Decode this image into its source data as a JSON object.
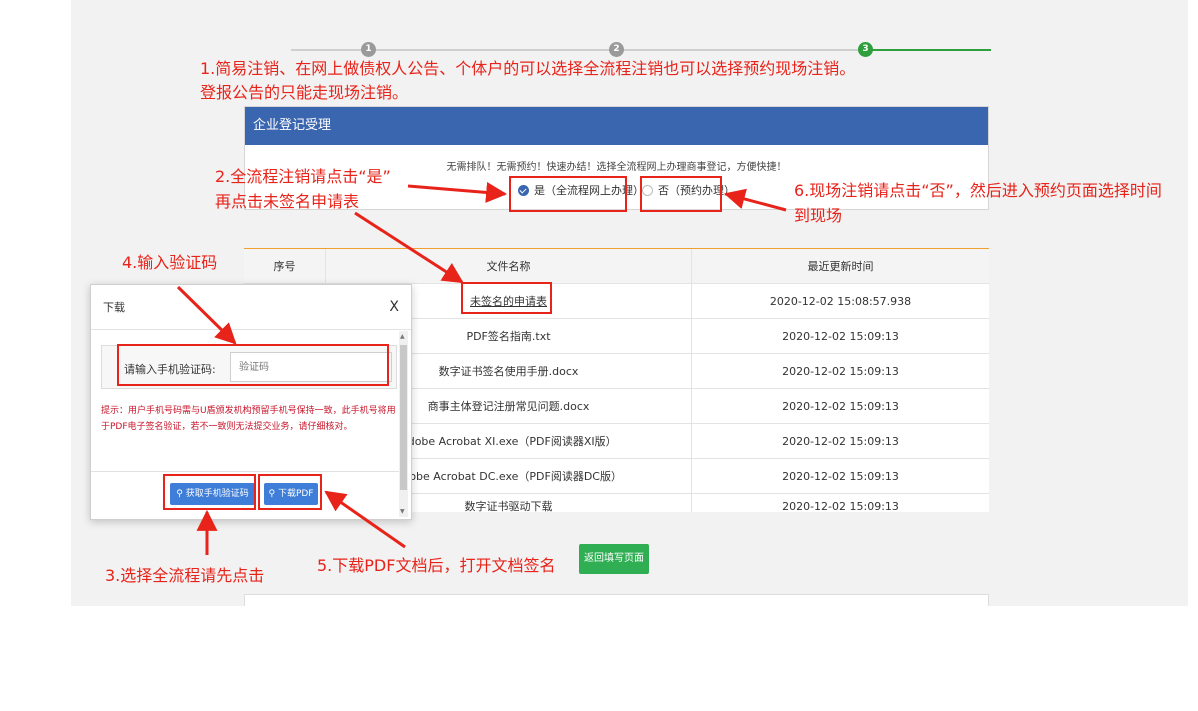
{
  "steps": [
    {
      "label": "",
      "number": "1"
    },
    {
      "label": "",
      "number": "2"
    },
    {
      "label": "",
      "number": "3"
    }
  ],
  "card": {
    "title": "企业登记受理",
    "notice": "无需排队！无需预约！快速办结！选择全流程网上办理商事登记，方便快捷！",
    "option_yes": "是（全流程网上办理）",
    "option_no": "否（预约办理）"
  },
  "files": {
    "headers": [
      "序号",
      "文件名称",
      "最近更新时间"
    ],
    "rows": [
      {
        "index": "",
        "name": "未签名的申请表",
        "time": "2020-12-02 15:08:57.938"
      },
      {
        "index": "",
        "name": "PDF签名指南.txt",
        "time": "2020-12-02 15:09:13"
      },
      {
        "index": "",
        "name": "数字证书签名使用手册.docx",
        "time": "2020-12-02 15:09:13"
      },
      {
        "index": "",
        "name": "商事主体登记注册常见问题.docx",
        "time": "2020-12-02 15:09:13"
      },
      {
        "index": "",
        "name": "Adobe Acrobat XI.exe（PDF阅读器XI版）",
        "time": "2020-12-02 15:09:13"
      },
      {
        "index": "",
        "name": "Adobe Acrobat DC.exe（PDF阅读器DC版）",
        "time": "2020-12-02 15:09:13"
      },
      {
        "index": "",
        "name": "数字证书驱动下载",
        "time": "2020-12-02 15:09:13"
      }
    ]
  },
  "back_button": "返回填写页面",
  "modal": {
    "title": "下载",
    "close": "X",
    "field_label": "请输入手机验证码:",
    "field_placeholder": "验证码",
    "tip": "提示：用户手机号码需与U盾颁发机构预留手机号保持一致，此手机号将用于PDF电子签名验证，若不一致则无法提交业务，请仔细核对。",
    "btn_sms": "获取手机验证码",
    "btn_pdf": "下载PDF"
  },
  "annotations": {
    "note1_line1": "1.简易注销、在网上做债权人公告、个体户的可以选择全流程注销也可以选择预约现场注销。",
    "note1_line2": "登报公告的只能走现场注销。",
    "note2_line1": "2.全流程注销请点击“是”",
    "note2_line2": "再点击未签名申请表",
    "note3": "3.选择全流程请先点击",
    "note4": "4.输入验证码",
    "note5": "5.下载PDF文档后，打开文档签名",
    "note6_line1": "6.现场注销请点击“否”，然后进入预约页面选择时间",
    "note6_line2": "到现场",
    "color": "#e8231a"
  }
}
